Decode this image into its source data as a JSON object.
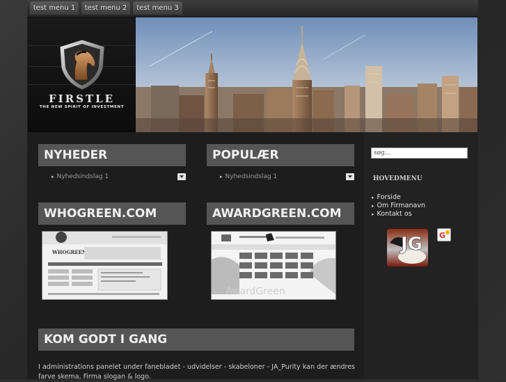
{
  "top_menu": [
    "test menu 1",
    "test menu 2",
    "test menu 3"
  ],
  "brand": {
    "name": "FIRSTLE",
    "slogan": "THE NEW SPIRIT OF INVESTMENT"
  },
  "modules": {
    "news": {
      "title": "NYHEDER",
      "item": "Nyhedsindslag 1"
    },
    "popular": {
      "title": "POPULÆR",
      "item": "Nyhedsindslag 1"
    },
    "whogreen": {
      "title": "WHOGREEN.COM",
      "thumb_logo": "WHOGREEN"
    },
    "awardgreen": {
      "title": "AWARDGREEN.COM",
      "thumb_logo": "AwardGreen"
    }
  },
  "getting_started": {
    "title": "KOM GODT I GANG",
    "text": "I administrations panelet under fanebladet - udvidelser - skabeloner - JA_Purity  kan der ændres farve skema, Firma slogan & logo."
  },
  "sidebar": {
    "search_placeholder": "søg...",
    "menu_title": "HOVEDMENU",
    "menu_items": [
      "Forside",
      "Om Firmanavn",
      "Kontakt os"
    ],
    "badge_letters": "JG"
  },
  "colors": {
    "module_bar": "#555555",
    "background": "#1d1d1d",
    "text": "#d0d0d0"
  }
}
